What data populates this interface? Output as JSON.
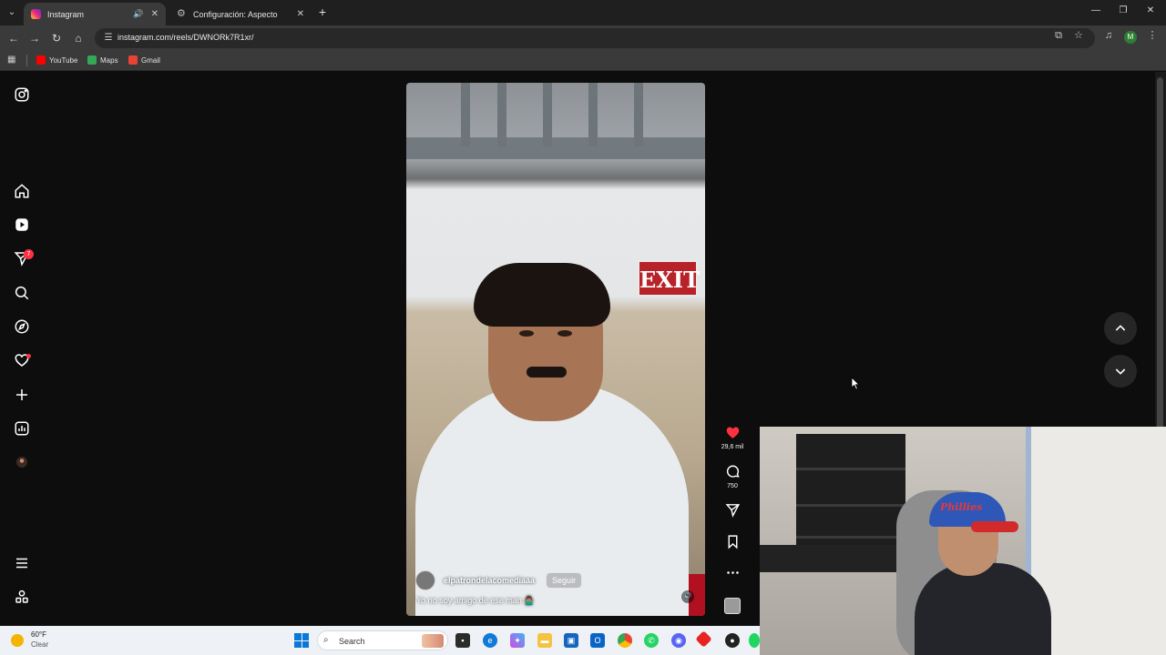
{
  "browser": {
    "tabs": [
      {
        "title": "Instagram",
        "active": true
      },
      {
        "title": "Configuración: Aspecto",
        "active": false
      }
    ],
    "url": "instagram.com/reels/DWNORk7R1xr/",
    "profile_initial": "M",
    "bookmarks": [
      {
        "label": "YouTube",
        "color": "#ff0000"
      },
      {
        "label": "Maps",
        "color": "#34a853"
      },
      {
        "label": "Gmail",
        "color": "#ea4335"
      }
    ]
  },
  "sidebar": {
    "notification_count": "7"
  },
  "reel": {
    "sign_text": "EXIT",
    "username": "elpatrondelacomediaaa",
    "follow_label": "Seguir",
    "caption": "Yo no soy amigo de ese man 🙅🏽‍♂️",
    "likes": "29,6 mil",
    "comments": "750"
  },
  "webcam": {
    "cap_text": "Phillies"
  },
  "taskbar": {
    "temperature": "60°F",
    "condition": "Clear",
    "search_placeholder": "Search"
  },
  "colors": {
    "like_red": "#ff3040",
    "page_bg": "#0d0d0d",
    "tab_active": "#3a3a3a"
  }
}
